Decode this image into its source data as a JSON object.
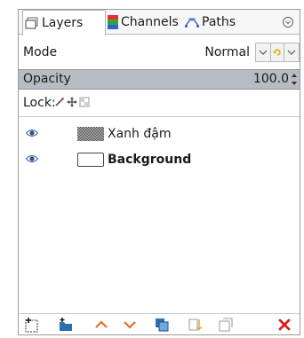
{
  "tabs": [
    {
      "label": "Layers",
      "icon": "layers-icon",
      "active": true
    },
    {
      "label": "Channels",
      "icon": "channels-icon"
    },
    {
      "label": "Paths",
      "icon": "paths-icon"
    }
  ],
  "mode": {
    "label": "Mode",
    "value": "Normal"
  },
  "opacity": {
    "label": "Opacity",
    "value": "100.0"
  },
  "lock": {
    "label": "Lock:",
    "icons": [
      "lock-pixels-icon",
      "lock-position-icon",
      "lock-alpha-icon"
    ]
  },
  "layers": [
    {
      "name": "Xanh đậm",
      "visible": true,
      "thumbnail": "pattern"
    },
    {
      "name": "Background",
      "visible": true,
      "thumbnail": "white"
    }
  ],
  "toolbar": [
    "new-layer-icon",
    "new-group-icon",
    "raise-layer-icon",
    "lower-layer-icon",
    "duplicate-layer-icon",
    "anchor-layer-icon",
    "mask-icon",
    "delete-layer-icon"
  ],
  "colors": {
    "selection": "#b7bcc4",
    "arrow": "#e0702a",
    "delete": "#d62020"
  }
}
